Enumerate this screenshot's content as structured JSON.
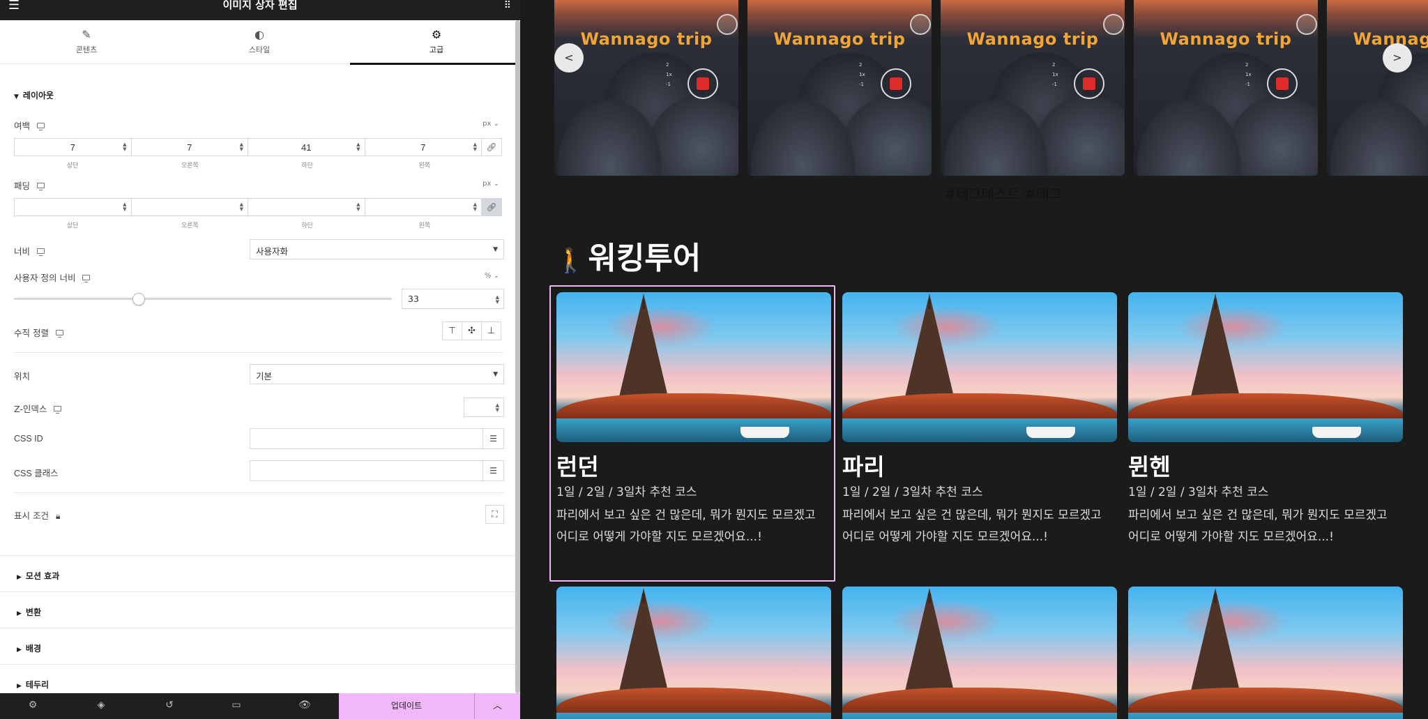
{
  "panel": {
    "title": "이미지 상자 편집",
    "tabs": [
      {
        "label": "콘텐츠",
        "icon": "pencil-icon"
      },
      {
        "label": "스타일",
        "icon": "half-circle-icon"
      },
      {
        "label": "고급",
        "icon": "gear-icon",
        "active": true
      }
    ],
    "layout": {
      "heading": "레이아웃",
      "margin": {
        "label": "여백",
        "unit": "px",
        "values": [
          "7",
          "7",
          "41",
          "7"
        ],
        "sides": [
          "상단",
          "오른쪽",
          "하단",
          "왼쪽"
        ]
      },
      "padding": {
        "label": "패딩",
        "unit": "px",
        "values": [
          "",
          "",
          "",
          ""
        ],
        "sides": [
          "상단",
          "오른쪽",
          "하단",
          "왼쪽"
        ]
      },
      "width": {
        "label": "너비",
        "value": "사용자화"
      },
      "custom_width": {
        "label": "사용자 정의 너비",
        "unit": "%",
        "value": "33",
        "slider_percent": 33
      },
      "vertical_align": {
        "label": "수직 정렬"
      },
      "position": {
        "label": "위치",
        "value": "기본"
      },
      "z_index": {
        "label": "Z-인덱스",
        "value": ""
      },
      "css_id": {
        "label": "CSS ID",
        "value": ""
      },
      "css_classes": {
        "label": "CSS 클래스",
        "value": ""
      },
      "display_conditions": {
        "label": "표시 조건"
      }
    },
    "collapsed_sections": [
      "모션 효과",
      "변환",
      "배경",
      "테두리"
    ],
    "footer": {
      "update_label": "업데이트"
    }
  },
  "preview": {
    "carousel": {
      "logo_text": "Wannago trip",
      "slides": 5,
      "tags": "#태그테스트 #태그"
    },
    "section_title": "워킹투어",
    "cards": [
      {
        "name": "런던",
        "sub": "1일 / 2일 / 3일차 추천 코스",
        "desc_line1": "파리에서 보고 싶은 건 많은데, 뭐가 뭔지도 모르겠고",
        "desc_line2": "어디로 어떻게 가야할 지도 모르겠어요...!"
      },
      {
        "name": "파리",
        "sub": "1일 / 2일 / 3일차 추천 코스",
        "desc_line1": "파리에서 보고 싶은 건 많은데, 뭐가 뭔지도 모르겠고",
        "desc_line2": "어디로 어떻게 가야할 지도 모르겠어요...!"
      },
      {
        "name": "뮌헨",
        "sub": "1일 / 2일 / 3일차 추천 코스",
        "desc_line1": "파리에서 보고 싶은 건 많은데, 뭐가 뭔지도 모르겠고",
        "desc_line2": "어디로 어떻게 가야할 지도 모르겠어요...!"
      }
    ]
  },
  "colors": {
    "accent": "#f0b8f8",
    "logo_orange": "#f4a531",
    "preview_bg": "#1b1b1b"
  }
}
